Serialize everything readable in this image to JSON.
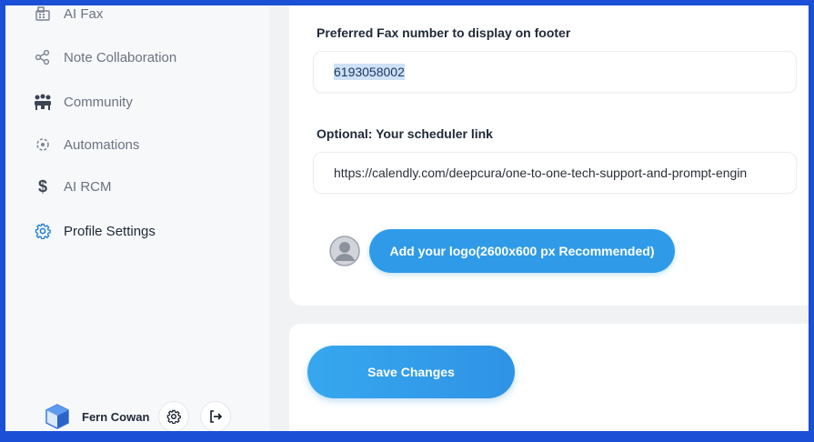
{
  "sidebar": {
    "items": [
      {
        "label": "AI Fax",
        "icon": "fax-icon"
      },
      {
        "label": "Note Collaboration",
        "icon": "share-icon"
      },
      {
        "label": "Community",
        "icon": "community-icon"
      },
      {
        "label": "Automations",
        "icon": "automation-icon"
      },
      {
        "label": "AI RCM",
        "icon": "dollar-icon"
      },
      {
        "label": "Profile Settings",
        "icon": "gear-icon",
        "active": true
      }
    ],
    "user": {
      "name": "Fern Cowan"
    }
  },
  "form": {
    "fax_label": "Preferred Fax number to display on footer",
    "fax_value": "6193058002",
    "scheduler_label": "Optional: Your scheduler link",
    "scheduler_value": "https://calendly.com/deepcura/one-to-one-tech-support-and-prompt-engin",
    "logo_button": "Add your logo(2600x600 px Recommended)",
    "save_button": "Save Changes"
  },
  "colors": {
    "accent": "#2f9be8",
    "frame": "#1a4fd6"
  }
}
